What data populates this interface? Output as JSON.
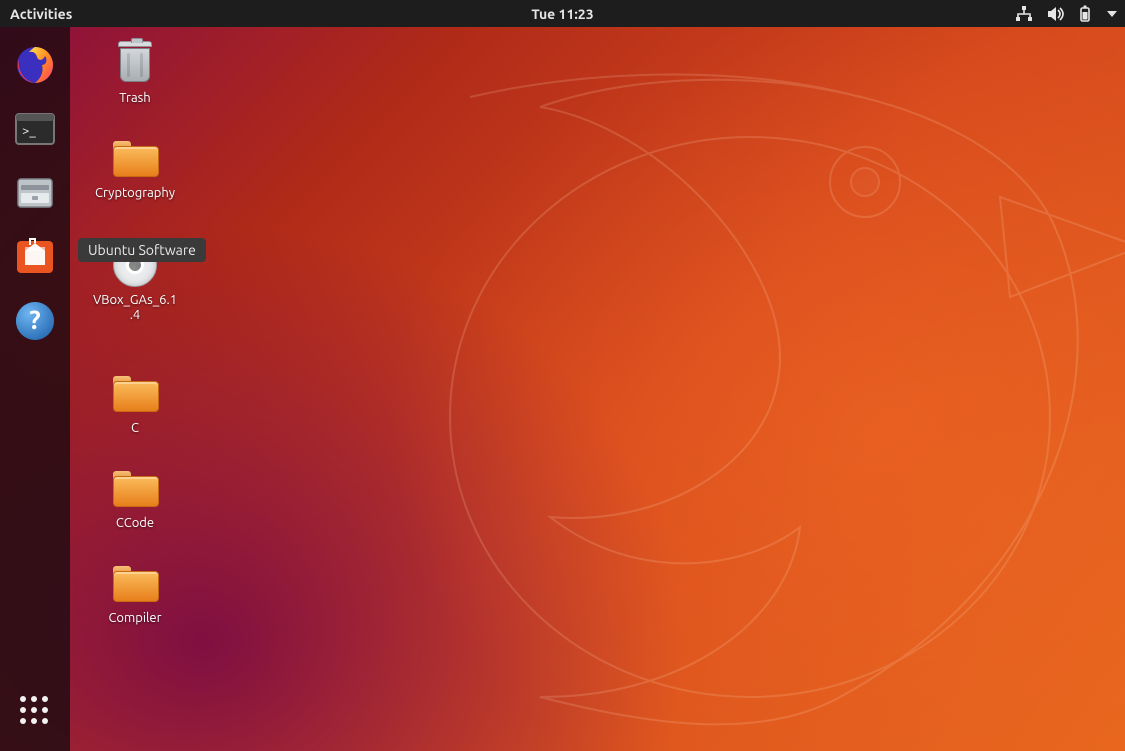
{
  "topbar": {
    "activities_label": "Activities",
    "clock": "Tue 11:23"
  },
  "dock": {
    "items": [
      {
        "name": "firefox-icon"
      },
      {
        "name": "terminal-icon"
      },
      {
        "name": "files-icon"
      },
      {
        "name": "software-icon"
      },
      {
        "name": "help-icon"
      }
    ],
    "apps_button_name": "show-applications"
  },
  "tooltip": {
    "text": "Ubuntu Software"
  },
  "desktop_icons": [
    {
      "kind": "trash",
      "label": "Trash",
      "name": "desktop-trash"
    },
    {
      "kind": "folder",
      "label": "Cryptography",
      "name": "folder-cryptography"
    },
    {
      "kind": "disc",
      "label": "VBox_GAs_6.1.4",
      "name": "disc-vbox-gas"
    },
    {
      "kind": "folder",
      "label": "C",
      "name": "folder-c"
    },
    {
      "kind": "folder",
      "label": "CCode",
      "name": "folder-ccode"
    },
    {
      "kind": "folder",
      "label": "Compiler",
      "name": "folder-compiler"
    }
  ],
  "colors": {
    "accent": "#e95420",
    "topbar_bg": "#1d1d1d"
  }
}
